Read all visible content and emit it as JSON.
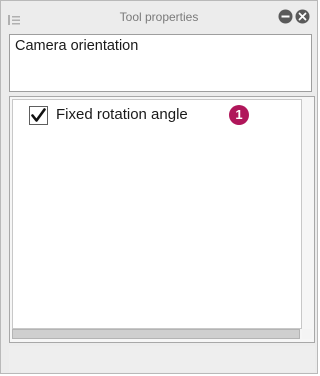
{
  "window": {
    "title": "Tool properties"
  },
  "tool": {
    "name": "Camera orientation"
  },
  "properties": [
    {
      "label": "Fixed rotation angle",
      "checked": true,
      "callout": "1"
    }
  ],
  "colors": {
    "callout": "#b0165a",
    "panel_bg": "#ececec"
  },
  "icons": {
    "grip": "panel-menu-grip-icon",
    "minimize": "minimize-icon",
    "close": "close-icon",
    "check": "checkmark-icon"
  }
}
